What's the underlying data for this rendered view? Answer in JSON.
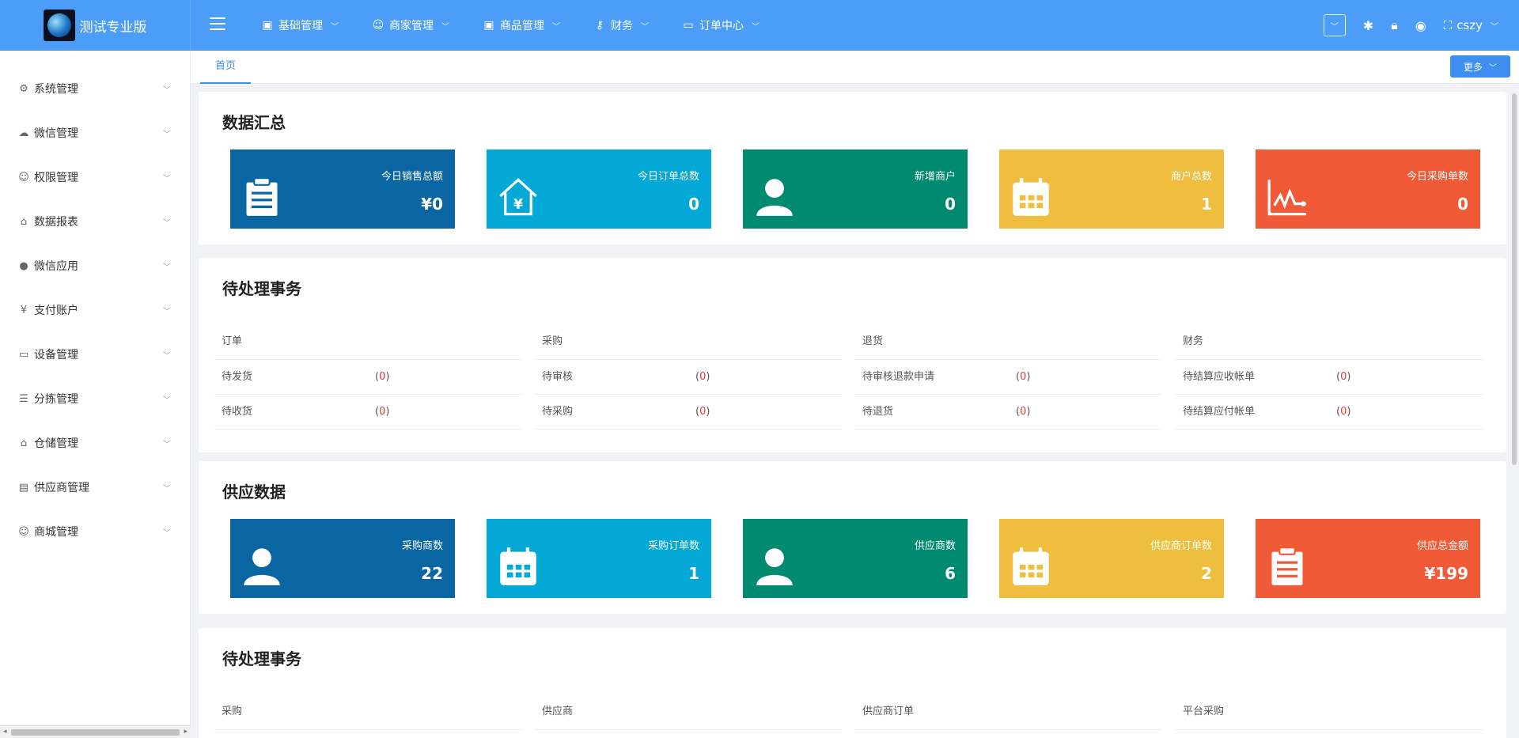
{
  "app": {
    "title": "测试专业版"
  },
  "topnav": [
    {
      "label": "基础管理",
      "icon": "monitor-icon"
    },
    {
      "label": "商家管理",
      "icon": "users-icon"
    },
    {
      "label": "商品管理",
      "icon": "monitor-icon"
    },
    {
      "label": "财务",
      "icon": "key-icon"
    },
    {
      "label": "订单中心",
      "icon": "laptop-icon"
    }
  ],
  "header": {
    "user": "cszy"
  },
  "sidebar": [
    {
      "label": "系统管理",
      "icon": "gear-icon"
    },
    {
      "label": "微信管理",
      "icon": "wechat-icon"
    },
    {
      "label": "权限管理",
      "icon": "user-icon"
    },
    {
      "label": "数据报表",
      "icon": "home-icon"
    },
    {
      "label": "微信应用",
      "icon": "chat-app-icon"
    },
    {
      "label": "支付账户",
      "icon": "yen-circle-icon"
    },
    {
      "label": "设备管理",
      "icon": "device-icon"
    },
    {
      "label": "分拣管理",
      "icon": "list-icon"
    },
    {
      "label": "仓储管理",
      "icon": "warehouse-icon"
    },
    {
      "label": "供应商管理",
      "icon": "clipboard-icon"
    },
    {
      "label": "商城管理",
      "icon": "users-icon"
    }
  ],
  "tabs": {
    "home": "首页",
    "more": "更多"
  },
  "summary": {
    "title": "数据汇总",
    "cards": [
      {
        "label": "今日销售总额",
        "value": "¥0",
        "color": "#0a66a3",
        "icon": "clipboard-icon"
      },
      {
        "label": "今日订单总数",
        "value": "0",
        "color": "#03a8d6",
        "icon": "house-yen-icon"
      },
      {
        "label": "新增商户",
        "value": "0",
        "color": "#008a70",
        "icon": "person-icon"
      },
      {
        "label": "商户总数",
        "value": "1",
        "color": "#efbe3e",
        "icon": "calendar-icon"
      },
      {
        "label": "今日采购单数",
        "value": "0",
        "color": "#f15a37",
        "icon": "line-chart-icon"
      }
    ]
  },
  "pending1": {
    "title": "待处理事务",
    "columns": [
      {
        "header": "订单",
        "rows": [
          {
            "label": "待发货",
            "count": "0"
          },
          {
            "label": "待收货",
            "count": "0"
          }
        ]
      },
      {
        "header": "采购",
        "rows": [
          {
            "label": "待审核",
            "count": "0"
          },
          {
            "label": "待采购",
            "count": "0"
          }
        ]
      },
      {
        "header": "退货",
        "rows": [
          {
            "label": "待审核退款申请",
            "count": "0"
          },
          {
            "label": "待退货",
            "count": "0"
          }
        ]
      },
      {
        "header": "财务",
        "rows": [
          {
            "label": "待结算应收帐单",
            "count": "0"
          },
          {
            "label": "待结算应付帐单",
            "count": "0"
          }
        ]
      }
    ]
  },
  "supply": {
    "title": "供应数据",
    "cards": [
      {
        "label": "采购商数",
        "value": "22",
        "color": "#0a66a3",
        "icon": "person-icon"
      },
      {
        "label": "采购订单数",
        "value": "1",
        "color": "#03a8d6",
        "icon": "calendar-icon"
      },
      {
        "label": "供应商数",
        "value": "6",
        "color": "#008a70",
        "icon": "person-icon"
      },
      {
        "label": "供应商订单数",
        "value": "2",
        "color": "#efbe3e",
        "icon": "calendar-icon"
      },
      {
        "label": "供应总金额",
        "value": "¥199",
        "color": "#f15a37",
        "icon": "clipboard-icon"
      }
    ]
  },
  "pending2": {
    "title": "待处理事务",
    "headers": [
      "采购",
      "供应商",
      "供应商订单",
      "平台采购"
    ]
  }
}
